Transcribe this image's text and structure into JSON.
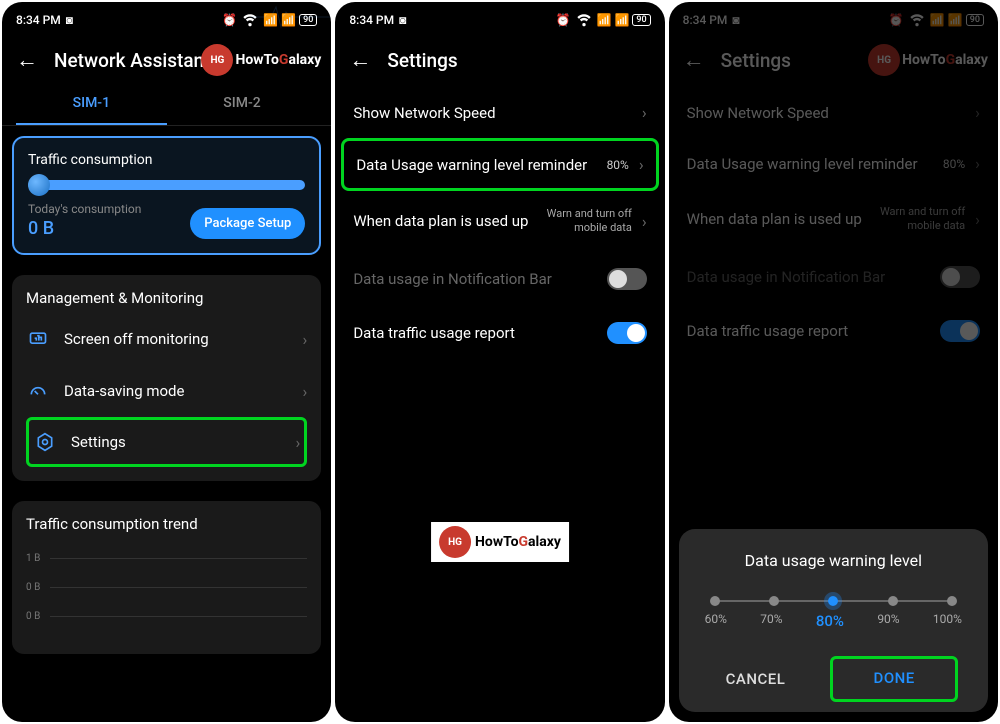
{
  "status": {
    "time": "8:34 PM",
    "battery": "90"
  },
  "logo": {
    "badge": "HG",
    "text_how": "HowTo",
    "text_g": "G",
    "text_rest": "alaxy"
  },
  "screen1": {
    "title": "Network Assistant",
    "tabs": [
      "SIM-1",
      "SIM-2"
    ],
    "traffic": {
      "title": "Traffic consumption",
      "today_label": "Today's consumption",
      "today_value": "0 B",
      "package_btn": "Package Setup"
    },
    "mgmt_title": "Management & Monitoring",
    "mgmt_items": [
      {
        "label": "Screen off monitoring",
        "icon": "monitor",
        "name": "screen-off-monitoring-row"
      },
      {
        "label": "Data-saving mode",
        "icon": "dial",
        "name": "data-saving-mode-row"
      },
      {
        "label": "Settings",
        "icon": "gear",
        "name": "settings-row"
      }
    ],
    "trend_title": "Traffic consumption trend",
    "trend_ticks": [
      "1 B",
      "0 B",
      "0 B"
    ]
  },
  "screen2": {
    "title": "Settings",
    "rows": {
      "network_speed": "Show Network Speed",
      "data_warning": "Data Usage warning level reminder",
      "data_warning_value": "80%",
      "data_plan": "When data plan is used up",
      "data_plan_value1": "Warn and turn off",
      "data_plan_value2": "mobile data",
      "notif_bar": "Data usage in Notification Bar",
      "traffic_report": "Data traffic usage report"
    }
  },
  "dialog": {
    "title": "Data usage warning level",
    "options": [
      "60%",
      "70%",
      "80%",
      "90%",
      "100%"
    ],
    "selected_index": 2,
    "cancel": "CANCEL",
    "done": "DONE"
  }
}
